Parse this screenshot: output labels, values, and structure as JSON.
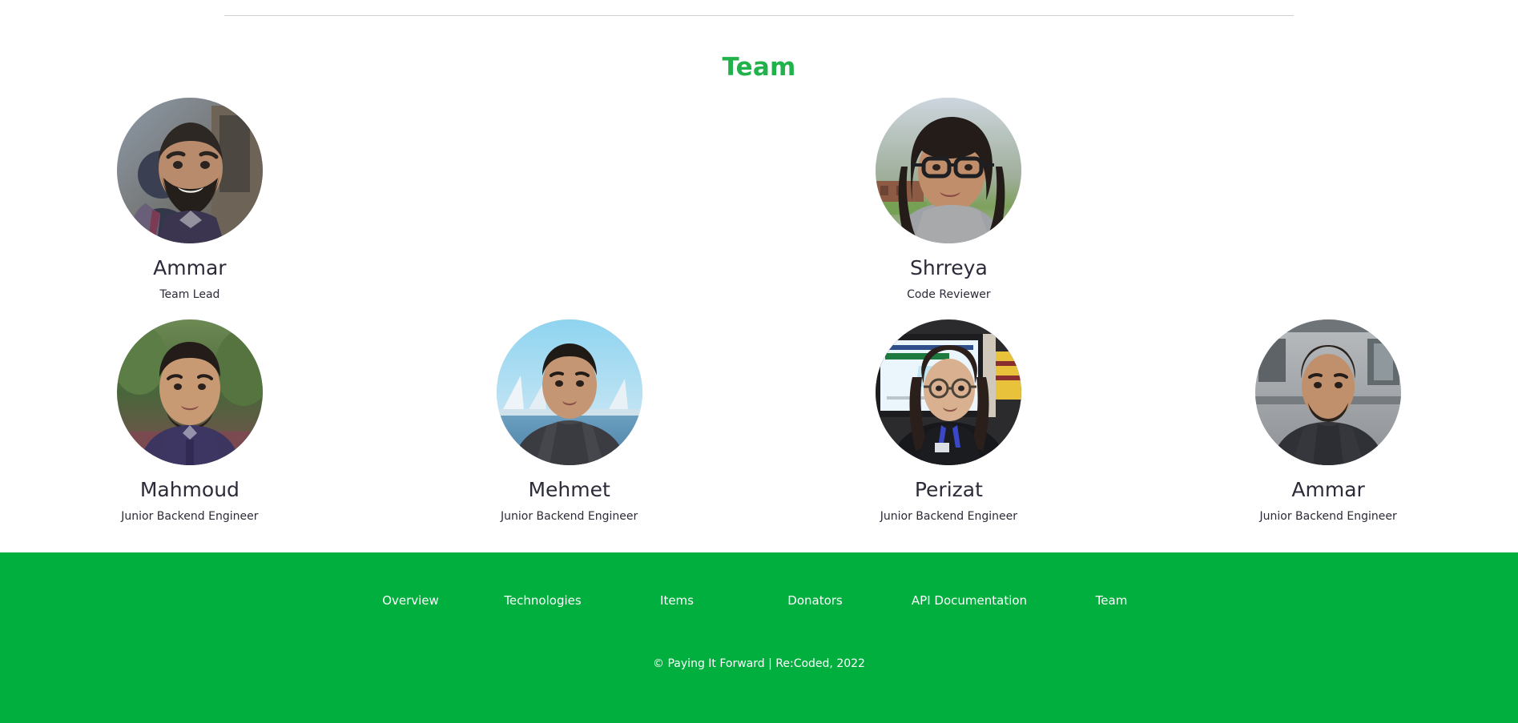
{
  "page": {
    "title": "Team",
    "title_color": "#22b24b",
    "background": "#ffffff",
    "text_color": "#2b2b39"
  },
  "team": {
    "rows": [
      {
        "members": [
          {
            "name": "Ammar",
            "role": "Team Lead",
            "avatar": "photo-portrait-bearded-man"
          },
          {
            "name": "",
            "role": "",
            "avatar": ""
          },
          {
            "name": "Shrreya",
            "role": "Code Reviewer",
            "avatar": "photo-portrait-woman-glasses"
          },
          {
            "name": "",
            "role": "",
            "avatar": ""
          }
        ]
      },
      {
        "members": [
          {
            "name": "Mahmoud",
            "role": "Junior Backend Engineer",
            "avatar": "photo-portrait-man-outdoors"
          },
          {
            "name": "Mehmet",
            "role": "Junior Backend Engineer",
            "avatar": "photo-portrait-man-harbor"
          },
          {
            "name": "Perizat",
            "role": "Junior Backend Engineer",
            "avatar": "photo-portrait-woman-presentation"
          },
          {
            "name": "Ammar",
            "role": "Junior Backend Engineer",
            "avatar": "photo-portrait-man-building"
          }
        ]
      }
    ]
  },
  "footer": {
    "background": "#00af3d",
    "text_color": "#ffffff",
    "links": [
      {
        "label": "Overview"
      },
      {
        "label": "Technologies"
      },
      {
        "label": "Items"
      },
      {
        "label": "Donators"
      },
      {
        "label": "API Documentation"
      },
      {
        "label": "Team"
      }
    ],
    "copyright": "© Paying It Forward | Re:Coded, 2022"
  }
}
